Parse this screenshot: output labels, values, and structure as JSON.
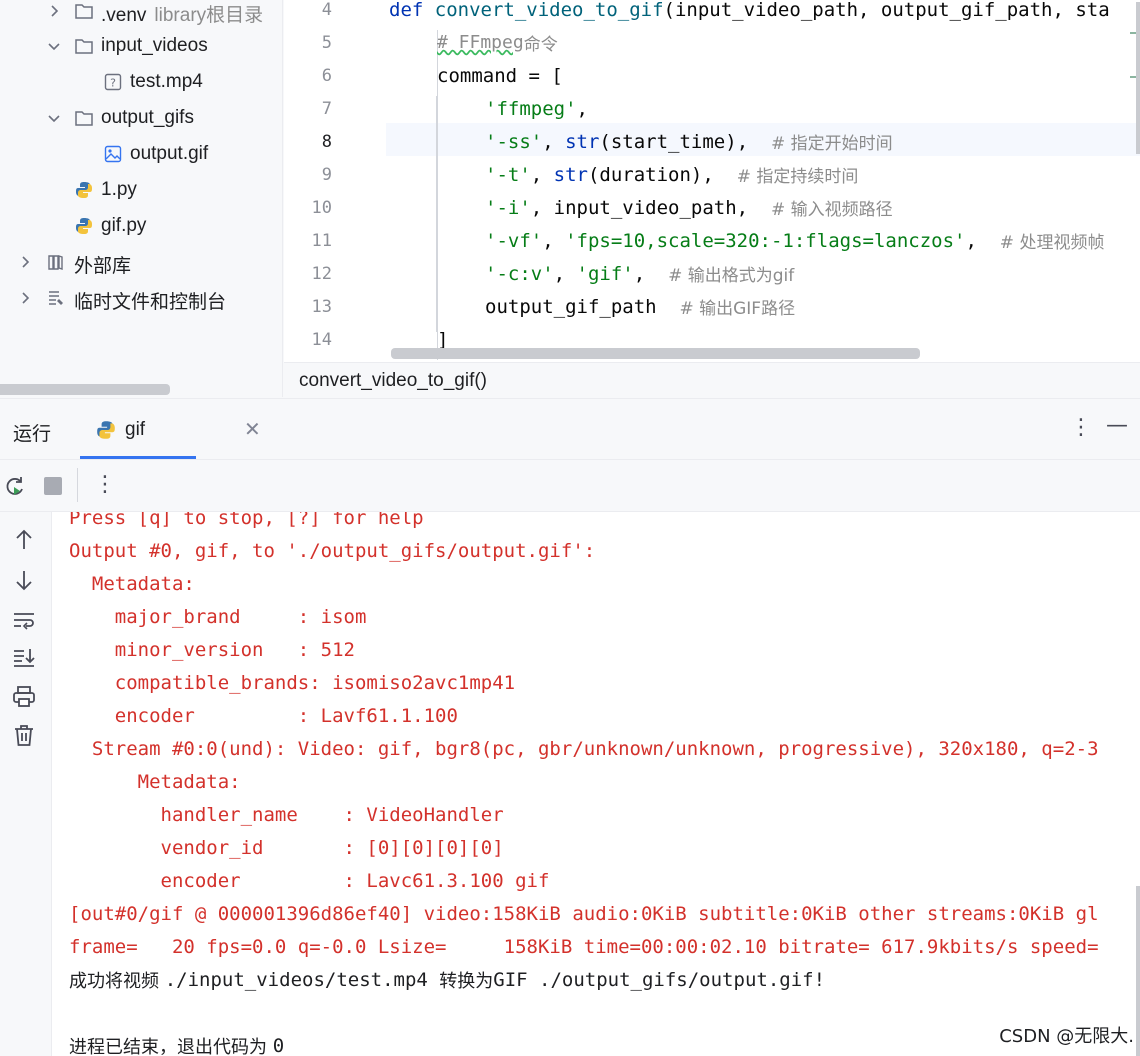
{
  "project_tree": {
    "items": [
      {
        "label": ".venv",
        "hint": "library根目录"
      },
      {
        "label": "input_videos"
      },
      {
        "label": "test.mp4"
      },
      {
        "label": "output_gifs"
      },
      {
        "label": "output.gif"
      },
      {
        "label": "1.py"
      },
      {
        "label": "gif.py"
      },
      {
        "label": "外部库"
      },
      {
        "label": "临时文件和控制台"
      }
    ]
  },
  "editor": {
    "line_numbers": [
      "4",
      "5",
      "6",
      "7",
      "8",
      "9",
      "10",
      "11",
      "12",
      "13",
      "14"
    ],
    "current_line": "8",
    "lines": [
      {
        "kw": "def ",
        "fn": "convert_video_to_gif",
        "rest": "(input_video_path, output_gif_path, sta"
      },
      {
        "comment_code": "# FFmpeg",
        "comment_cjk": "命令"
      },
      {
        "code": "command = ["
      },
      {
        "str1": "'ffmpeg'",
        "tail": ","
      },
      {
        "str1": "'-ss'",
        "mid": ", ",
        "bi": "str",
        "tail": "(start_time),  ",
        "comment": "# 指定开始时间"
      },
      {
        "str1": "'-t'",
        "mid": ", ",
        "bi": "str",
        "tail": "(duration),  ",
        "comment": "# 指定持续时间"
      },
      {
        "str1": "'-i'",
        "tail": ", input_video_path,  ",
        "comment": "# 输入视频路径"
      },
      {
        "str1": "'-vf'",
        "mid": ", ",
        "str2": "'fps=10,scale=320:-1:flags=lanczos'",
        "tail": ",  ",
        "comment": "# 处理视频帧"
      },
      {
        "str1": "'-c:v'",
        "mid": ", ",
        "str2": "'gif'",
        "tail": ",  ",
        "comment": "# 输出格式为gif"
      },
      {
        "code": "output_gif_path  ",
        "comment": "# 输出GIF路径"
      },
      {
        "code": "]"
      }
    ]
  },
  "breadcrumb": "convert_video_to_gif()",
  "run_window": {
    "title": "运行",
    "tab_label": "gif",
    "more_icon": "⋮",
    "minimize_icon": "—"
  },
  "console": {
    "lines": [
      "Press [q] to stop, [?] for help",
      "Output #0, gif, to './output_gifs/output.gif':",
      "  Metadata:",
      "    major_brand     : isom",
      "    minor_version   : 512",
      "    compatible_brands: isomiso2avc1mp41",
      "    encoder         : Lavf61.1.100",
      "  Stream #0:0(und): Video: gif, bgr8(pc, gbr/unknown/unknown, progressive), 320x180, q=2-3",
      "      Metadata:",
      "        handler_name    : VideoHandler",
      "        vendor_id       : [0][0][0][0]",
      "        encoder         : Lavc61.3.100 gif",
      "[out#0/gif @ 000001396d86ef40] video:158KiB audio:0KiB subtitle:0KiB other streams:0KiB gl",
      "frame=   20 fps=0.0 q=-0.0 Lsize=     158KiB time=00:00:02.10 bitrate= 617.9kbits/s speed="
    ],
    "success_prefix": "成功将视频 ",
    "success_path1": "./input_videos/test.mp4 ",
    "success_mid": "转换为",
    "success_path2": "GIF ./output_gifs/output.gif!",
    "exit_prefix": "进程已结束，退出代码为 ",
    "exit_code": "0"
  },
  "watermark": "CSDN @无限大.",
  "colors": {
    "accent": "#3574f0",
    "error_text": "#d3312b",
    "keyword": "#0033b3",
    "function": "#00627a",
    "string": "#067d17",
    "comment": "#8c8c8c"
  }
}
